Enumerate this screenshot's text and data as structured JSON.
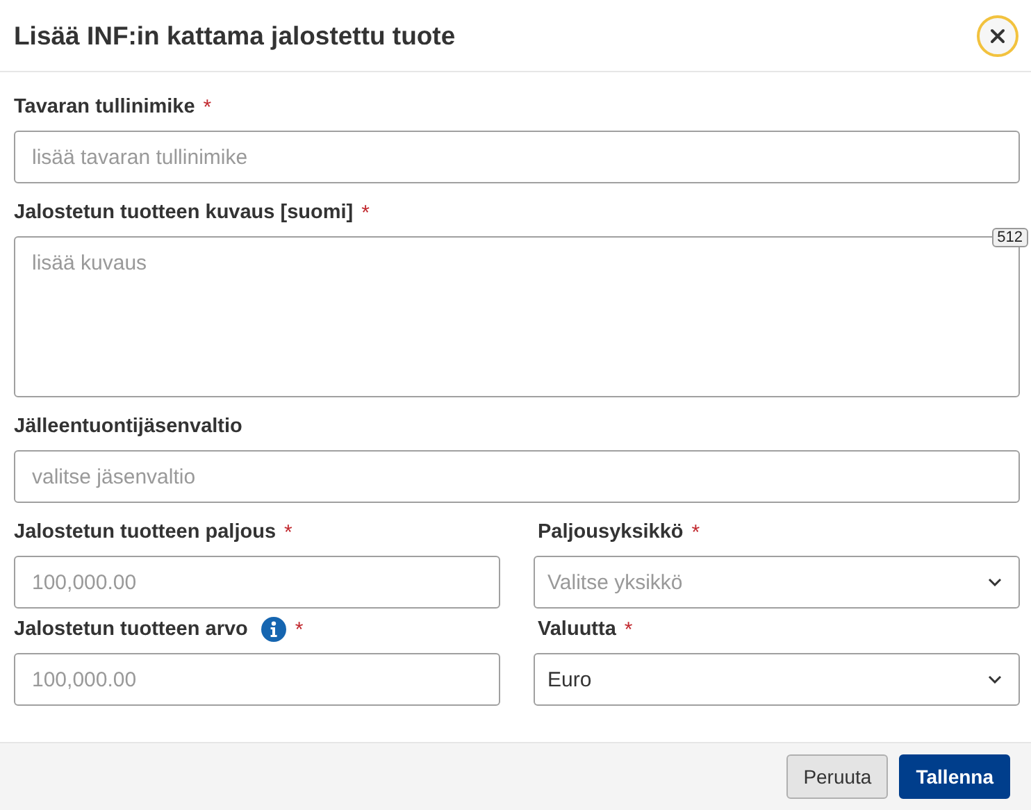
{
  "dialog": {
    "title": "Lisää INF:in kattama jalostettu tuote"
  },
  "rows": [
    [
      {
        "kind": "text",
        "label": "Tavaran tullinimike",
        "required_mark": "*",
        "placeholder": "lisää tavaran tullinimike"
      }
    ],
    [
      {
        "kind": "textarea",
        "label": "Jalostetun tuotteen kuvaus [suomi]",
        "required_mark": "*",
        "placeholder": "lisää kuvaus",
        "counter": "512"
      }
    ],
    [
      {
        "kind": "text",
        "label": "Jälleentuontijäsenvaltio",
        "placeholder": "valitse jäsenvaltio"
      }
    ],
    [
      {
        "kind": "text",
        "label": "Jalostetun tuotteen paljous",
        "required_mark": "*",
        "placeholder": "100,000.00"
      },
      {
        "kind": "select",
        "label": "Paljousyksikkö",
        "required_mark": "*",
        "placeholder": "Valitse yksikkö"
      }
    ],
    [
      {
        "kind": "text",
        "label": "Jalostetun tuotteen arvo",
        "info": true,
        "required_mark": "*",
        "placeholder": "100,000.00"
      },
      {
        "kind": "select",
        "label": "Valuutta",
        "required_mark": "*",
        "value": "Euro"
      }
    ]
  ],
  "buttons": [
    {
      "label": "Peruuta",
      "kind": "secondary"
    },
    {
      "label": "Tallenna",
      "kind": "primary"
    }
  ]
}
